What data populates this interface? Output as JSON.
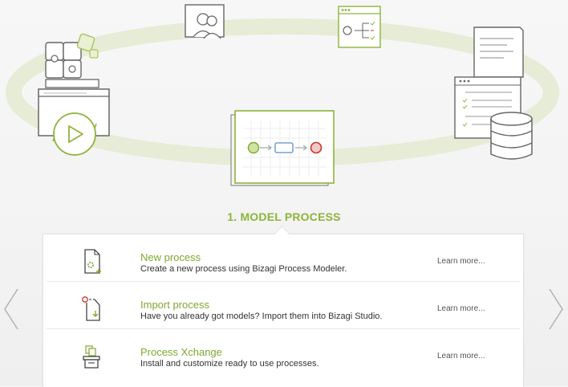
{
  "step": {
    "title": "1. MODEL PROCESS"
  },
  "options": [
    {
      "title": "New process",
      "description": "Create a new process using Bizagi Process Modeler.",
      "link": "Learn more..."
    },
    {
      "title": "Import process",
      "description": "Have you already got models? Import them into Bizagi Studio.",
      "link": "Learn more..."
    },
    {
      "title": "Process Xchange",
      "description": "Install and customize ready to use processes.",
      "link": "Learn more..."
    }
  ],
  "icons": {
    "prev": "chevron-left-icon",
    "next": "chevron-right-icon",
    "new_process": "new-process-file-icon",
    "import_process": "import-file-icon",
    "xchange": "process-xchange-icon"
  },
  "colors": {
    "accent": "#8db43a",
    "link": "#7fa82e",
    "orbit": "#e8edd8",
    "stroke": "#666666",
    "text": "#333333"
  }
}
